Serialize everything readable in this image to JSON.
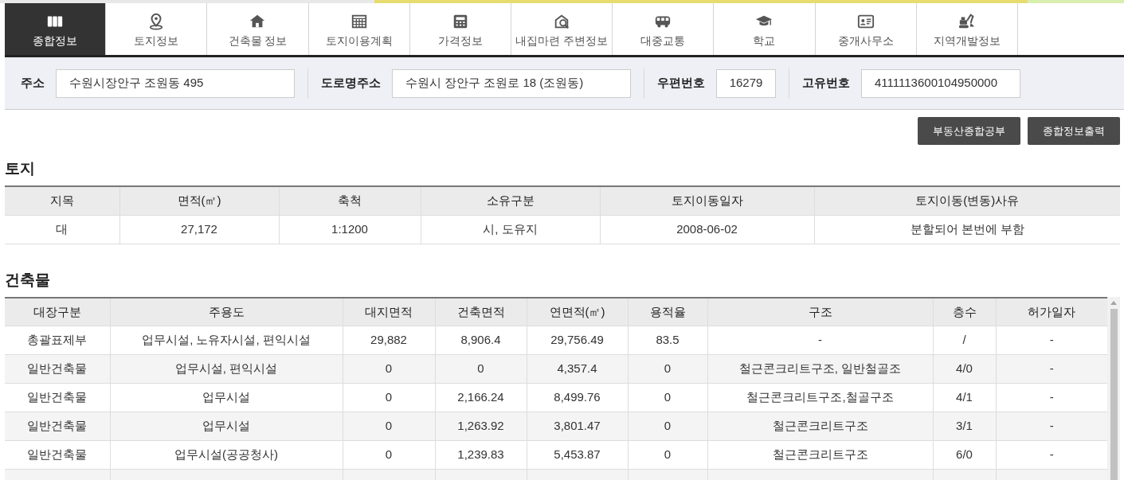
{
  "tabs": [
    {
      "label": "종합정보",
      "selected": true
    },
    {
      "label": "토지정보",
      "selected": false
    },
    {
      "label": "건축물 정보",
      "selected": false
    },
    {
      "label": "토지이용계획",
      "selected": false
    },
    {
      "label": "가격정보",
      "selected": false
    },
    {
      "label": "내집마련 주변정보",
      "selected": false
    },
    {
      "label": "대중교통",
      "selected": false
    },
    {
      "label": "학교",
      "selected": false
    },
    {
      "label": "중개사무소",
      "selected": false
    },
    {
      "label": "지역개발정보",
      "selected": false
    }
  ],
  "info_fields": [
    {
      "label": "주소",
      "value": "수원시장안구 조원동 495"
    },
    {
      "label": "도로명주소",
      "value": "수원시 장안구 조원로 18 (조원동)"
    },
    {
      "label": "우편번호",
      "value": "16279"
    },
    {
      "label": "고유번호",
      "value": "4111113600104950000"
    }
  ],
  "buttons": [
    "부동산종합공부",
    "종합정보출력"
  ],
  "land": {
    "title": "토지",
    "columns": [
      "지목",
      "면적(㎡)",
      "축척",
      "소유구분",
      "토지이동일자",
      "토지이동(변동)사유"
    ],
    "rows": [
      [
        "대",
        "27,172",
        "1:1200",
        "시, 도유지",
        "2008-06-02",
        "분할되어 본번에 부함"
      ]
    ]
  },
  "building": {
    "title": "건축물",
    "columns": [
      "대장구분",
      "주용도",
      "대지면적",
      "건축면적",
      "연면적(㎡)",
      "용적율",
      "구조",
      "층수",
      "허가일자"
    ],
    "rows": [
      [
        "총괄표제부",
        "업무시설, 노유자시설, 편익시설",
        "29,882",
        "8,906.4",
        "29,756.49",
        "83.5",
        "-",
        "/",
        "-"
      ],
      [
        "일반건축물",
        "업무시설, 편익시설",
        "0",
        "0",
        "4,357.4",
        "0",
        "철근콘크리트구조, 일반철골조",
        "4/0",
        "-"
      ],
      [
        "일반건축물",
        "업무시설",
        "0",
        "2,166.24",
        "8,499.76",
        "0",
        "철근콘크리트구조,철골구조",
        "4/1",
        "-"
      ],
      [
        "일반건축물",
        "업무시설",
        "0",
        "1,263.92",
        "3,801.47",
        "0",
        "철근콘크리트구조",
        "3/1",
        "-"
      ],
      [
        "일반건축물",
        "업무시설(공공청사)",
        "0",
        "1,239.83",
        "5,453.87",
        "0",
        "철근콘크리트구조",
        "6/0",
        "-"
      ]
    ]
  }
}
